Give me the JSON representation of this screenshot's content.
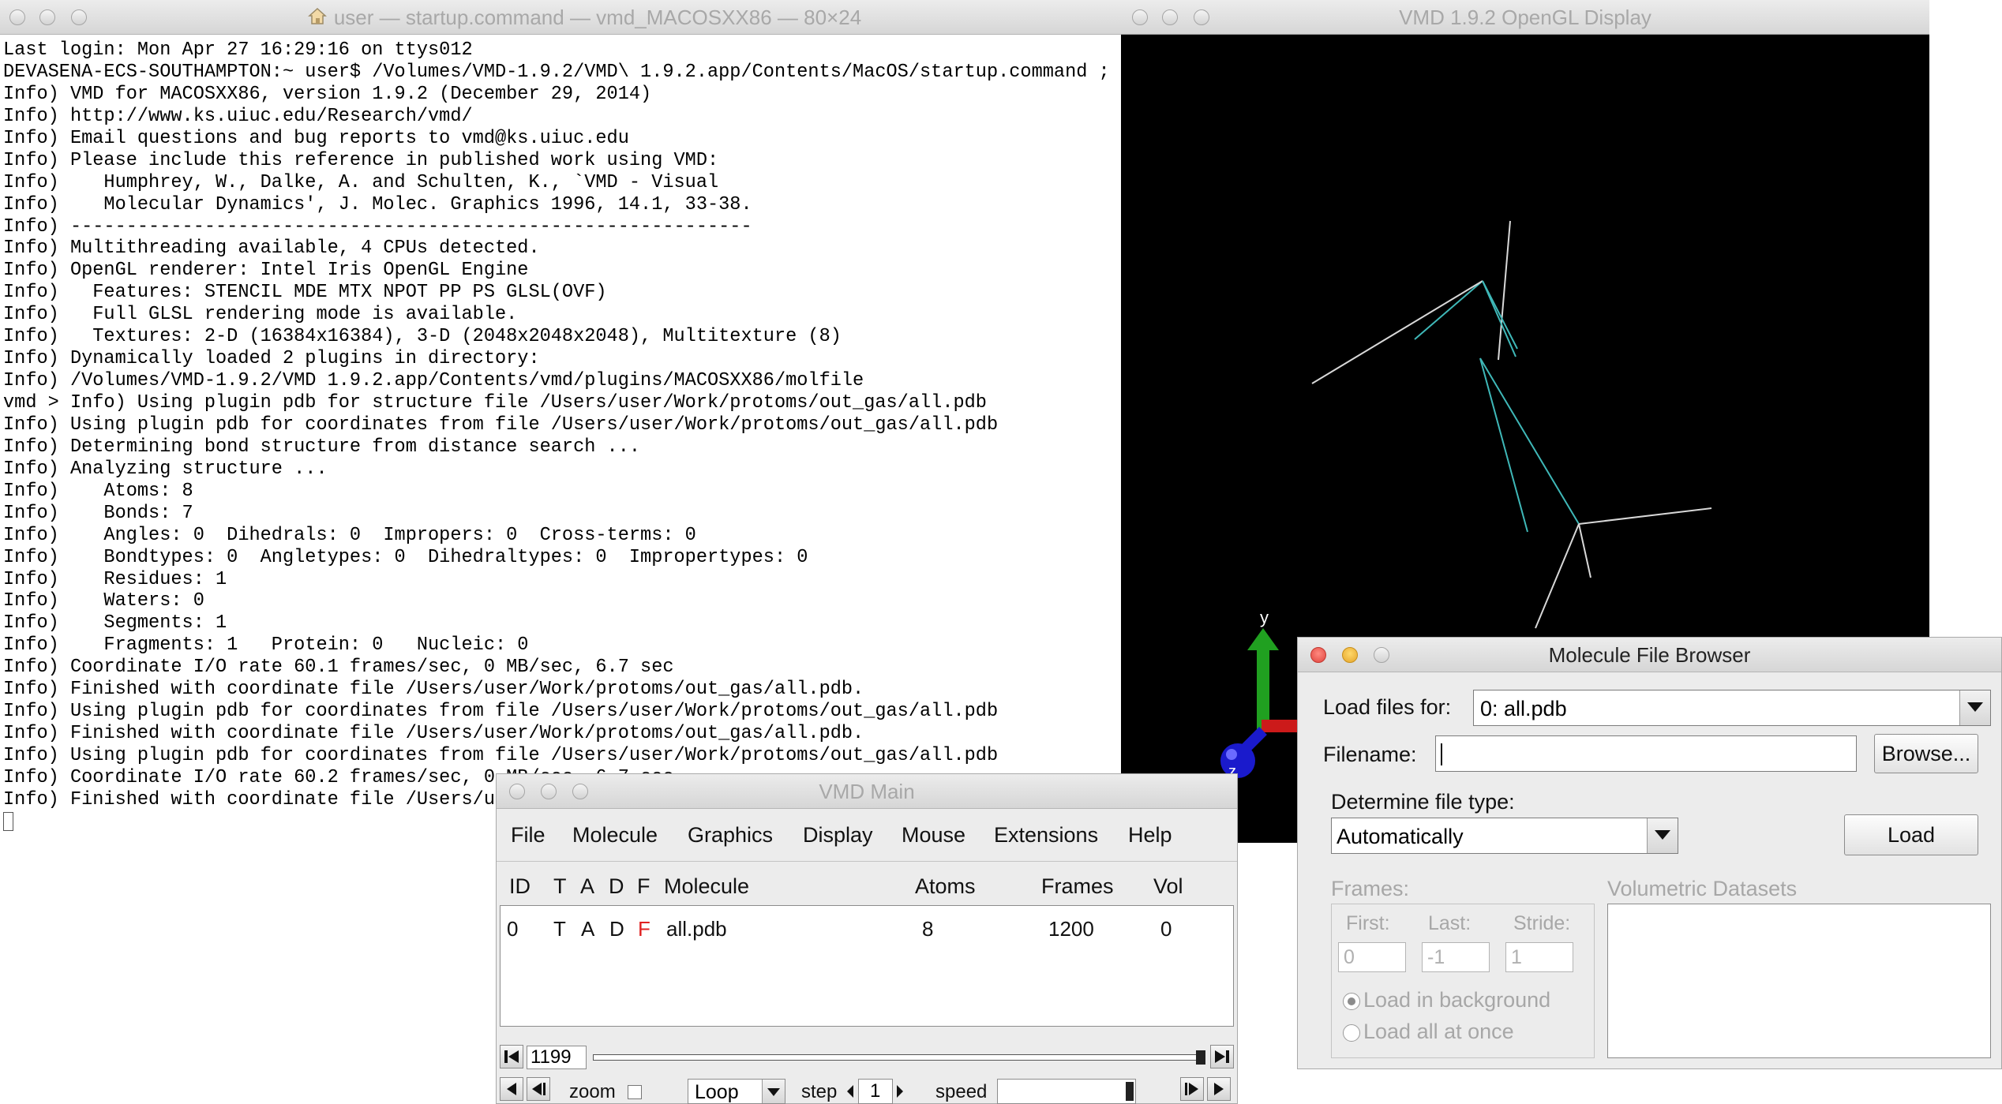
{
  "terminal": {
    "title": "user — startup.command — vmd_MACOSXX86 — 80×24",
    "lines": [
      "Last login: Mon Apr 27 16:29:16 on ttys012",
      "DEVASENA-ECS-SOUTHAMPTON:~ user$ /Volumes/VMD-1.9.2/VMD\\ 1.9.2.app/Contents/MacOS/startup.command ; e",
      "Info) VMD for MACOSXX86, version 1.9.2 (December 29, 2014)",
      "Info) http://www.ks.uiuc.edu/Research/vmd/",
      "Info) Email questions and bug reports to vmd@ks.uiuc.edu",
      "Info) Please include this reference in published work using VMD:",
      "Info)    Humphrey, W., Dalke, A. and Schulten, K., `VMD - Visual",
      "Info)    Molecular Dynamics', J. Molec. Graphics 1996, 14.1, 33-38.",
      "Info) -------------------------------------------------------------",
      "Info) Multithreading available, 4 CPUs detected.",
      "Info) OpenGL renderer: Intel Iris OpenGL Engine",
      "Info)   Features: STENCIL MDE MTX NPOT PP PS GLSL(OVF)",
      "Info)   Full GLSL rendering mode is available.",
      "Info)   Textures: 2-D (16384x16384), 3-D (2048x2048x2048), Multitexture (8)",
      "Info) Dynamically loaded 2 plugins in directory:",
      "Info) /Volumes/VMD-1.9.2/VMD 1.9.2.app/Contents/vmd/plugins/MACOSXX86/molfile",
      "vmd > Info) Using plugin pdb for structure file /Users/user/Work/protoms/out_gas/all.pdb",
      "Info) Using plugin pdb for coordinates from file /Users/user/Work/protoms/out_gas/all.pdb",
      "Info) Determining bond structure from distance search ...",
      "Info) Analyzing structure ...",
      "Info)    Atoms: 8",
      "Info)    Bonds: 7",
      "Info)    Angles: 0  Dihedrals: 0  Impropers: 0  Cross-terms: 0",
      "Info)    Bondtypes: 0  Angletypes: 0  Dihedraltypes: 0  Impropertypes: 0",
      "Info)    Residues: 1",
      "Info)    Waters: 0",
      "Info)    Segments: 1",
      "Info)    Fragments: 1   Protein: 0   Nucleic: 0",
      "Info) Coordinate I/O rate 60.1 frames/sec, 0 MB/sec, 6.7 sec",
      "Info) Finished with coordinate file /Users/user/Work/protoms/out_gas/all.pdb.",
      "Info) Using plugin pdb for coordinates from file /Users/user/Work/protoms/out_gas/all.pdb",
      "Info) Finished with coordinate file /Users/user/Work/protoms/out_gas/all.pdb.",
      "Info) Using plugin pdb for coordinates from file /Users/user/Work/protoms/out_gas/all.pdb",
      "Info) Coordinate I/O rate 60.2 frames/sec, 0 MB/sec, 6.7 sec",
      "Info) Finished with coordinate file /Users/user/Work/protoms/out_gas/all.pdb."
    ]
  },
  "display": {
    "title": "VMD 1.9.2 OpenGL Display",
    "axes": {
      "x": "x",
      "y": "y",
      "z": "z"
    }
  },
  "vmd_main": {
    "title": "VMD Main",
    "menus": [
      "File",
      "Molecule",
      "Graphics",
      "Display",
      "Mouse",
      "Extensions",
      "Help"
    ],
    "columns": [
      "ID",
      "T",
      "A",
      "D",
      "F",
      "Molecule",
      "Atoms",
      "Frames",
      "Vol"
    ],
    "rows": [
      {
        "id": "0",
        "t": "T",
        "a": "A",
        "d": "D",
        "f": "F",
        "molecule": "all.pdb",
        "atoms": "8",
        "frames": "1200",
        "vol": "0"
      }
    ],
    "frame_value": "1199",
    "frame_fraction": 1.0,
    "zoom_label": "zoom",
    "loop_value": "Loop",
    "step_label": "step",
    "step_value": "1",
    "speed_label": "speed",
    "speed_fraction": 1.0
  },
  "file_browser": {
    "title": "Molecule File Browser",
    "load_for_label": "Load files for:",
    "load_for_value": "0: all.pdb",
    "filename_label": "Filename:",
    "filename_value": "",
    "browse_label": "Browse...",
    "filetype_label": "Determine file type:",
    "filetype_value": "Automatically",
    "load_label": "Load",
    "frames_label": "Frames:",
    "first_label": "First:",
    "first_value": "0",
    "last_label": "Last:",
    "last_value": "-1",
    "stride_label": "Stride:",
    "stride_value": "1",
    "load_background_label": "Load in background",
    "load_all_label": "Load all at once",
    "volumetric_label": "Volumetric Datasets"
  },
  "colors": {
    "terminal_bg": "#ffffff",
    "display_bg": "#000000",
    "bond_cyan": "#3fb8b8",
    "bond_white": "#d8d8d8",
    "frame_flag_red": "#e02020",
    "axis_y_green": "#20a020",
    "axis_z_blue": "#1a1acc",
    "axis_x_red": "#cc1a1a"
  }
}
